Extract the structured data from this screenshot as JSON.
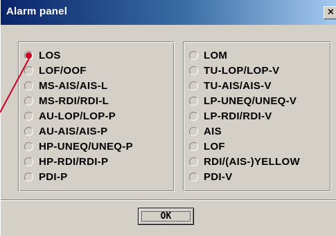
{
  "window": {
    "title": "Alarm panel",
    "close_glyph": "×"
  },
  "left_group": {
    "options": [
      {
        "label": "LOS",
        "checked": true
      },
      {
        "label": "LOF/OOF",
        "checked": false
      },
      {
        "label": "MS-AIS/AIS-L",
        "checked": false
      },
      {
        "label": "MS-RDI/RDI-L",
        "checked": false
      },
      {
        "label": "AU-LOP/LOP-P",
        "checked": false
      },
      {
        "label": "AU-AIS/AIS-P",
        "checked": false
      },
      {
        "label": "HP-UNEQ/UNEQ-P",
        "checked": false
      },
      {
        "label": "HP-RDI/RDI-P",
        "checked": false
      },
      {
        "label": "PDI-P",
        "checked": false
      }
    ]
  },
  "right_group": {
    "options": [
      {
        "label": "LOM",
        "checked": false
      },
      {
        "label": "TU-LOP/LOP-V",
        "checked": false
      },
      {
        "label": "TU-AIS/AIS-V",
        "checked": false
      },
      {
        "label": "LP-UNEQ/UNEQ-V",
        "checked": false
      },
      {
        "label": "LP-RDI/RDI-V",
        "checked": false
      },
      {
        "label": "AIS",
        "checked": false
      },
      {
        "label": "LOF",
        "checked": false
      },
      {
        "label": "RDI/(AIS-)YELLOW",
        "checked": false
      },
      {
        "label": "PDI-V",
        "checked": false
      }
    ]
  },
  "footer": {
    "ok_label": "OK"
  },
  "colors": {
    "selected_radio": "#cc0022",
    "callout_line": "#cc0022",
    "title_bar": "#0a246a",
    "window_face": "#d4d0c8"
  }
}
